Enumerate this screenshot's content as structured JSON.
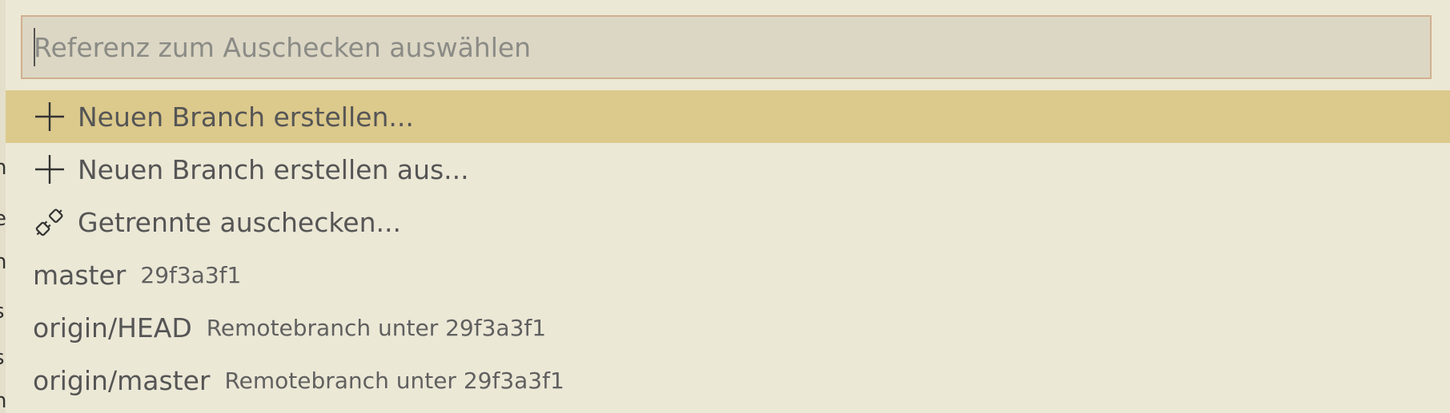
{
  "quick_pick": {
    "input": {
      "value": "",
      "placeholder": "Referenz zum Auschecken auswählen"
    },
    "actions": [
      {
        "icon": "plus-icon",
        "label": "Neuen Branch erstellen...",
        "selected": true
      },
      {
        "icon": "plus-icon",
        "label": "Neuen Branch erstellen aus...",
        "selected": false
      },
      {
        "icon": "disconnected-plug-icon",
        "label": "Getrennte auschecken...",
        "selected": false
      }
    ],
    "refs": [
      {
        "name": "master",
        "description": "29f3a3f1"
      },
      {
        "name": "origin/HEAD",
        "description": "Remotebranch unter 29f3a3f1"
      },
      {
        "name": "origin/master",
        "description": "Remotebranch unter 29f3a3f1"
      }
    ]
  },
  "colors": {
    "background": "#ece8d6",
    "selected_row": "#dcc98c",
    "input_background": "#dcd7c4",
    "input_border": "#d0b090",
    "text": "#555555",
    "placeholder": "#8b8b86"
  }
}
